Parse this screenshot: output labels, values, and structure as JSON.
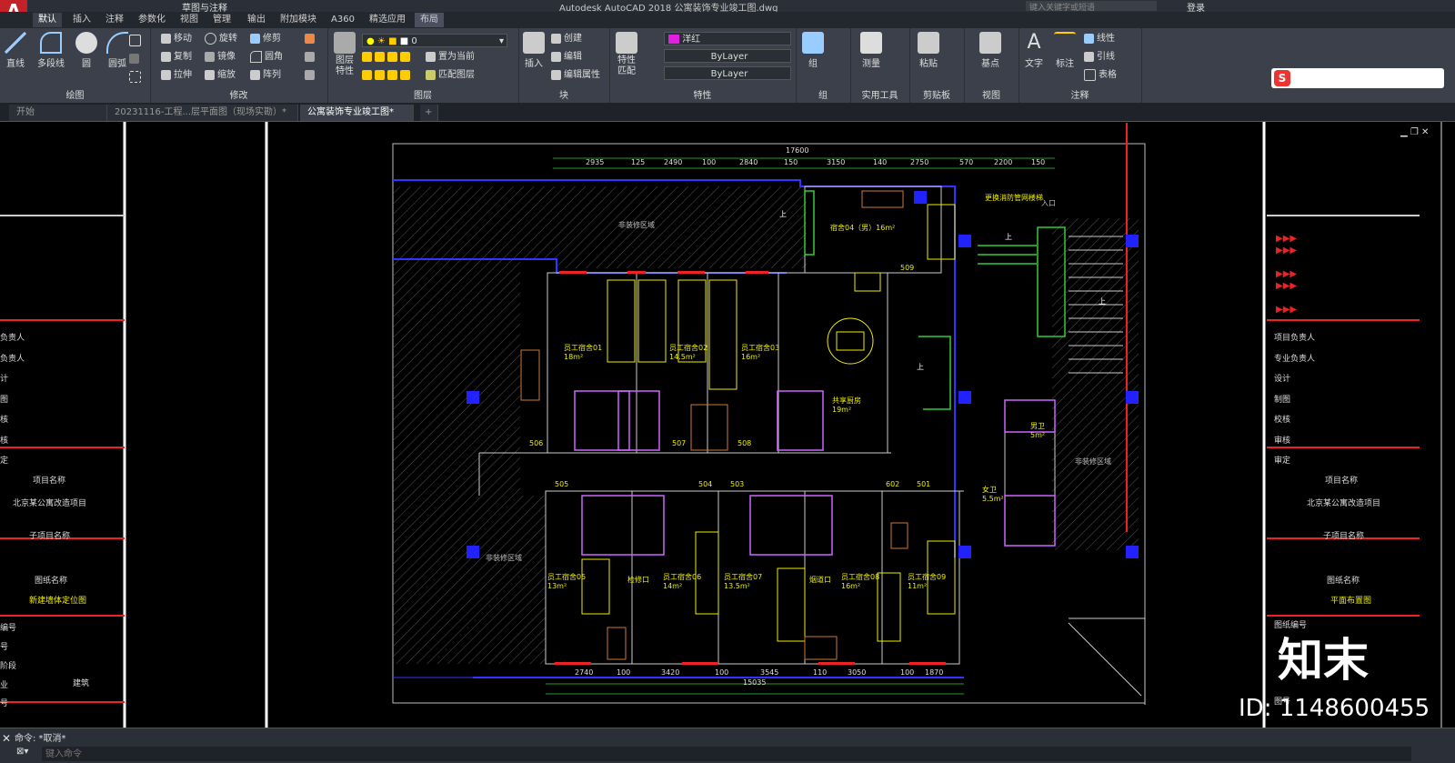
{
  "title_bar": {
    "app_logo": "A",
    "workspace": "草图与注释",
    "title": "Autodesk AutoCAD 2018    公寓装饰专业竣工图.dwg",
    "search_placeholder": "键入关键字或短语",
    "login": "登录"
  },
  "ribbon_tabs": [
    "默认",
    "插入",
    "注释",
    "参数化",
    "视图",
    "管理",
    "输出",
    "附加模块",
    "A360",
    "精选应用",
    "布局"
  ],
  "panels": {
    "draw": {
      "label": "绘图",
      "line": "直线",
      "polyline": "多段线",
      "circle": "圆",
      "arc": "圆弧"
    },
    "modify": {
      "label": "修改",
      "move": "移动",
      "rotate": "旋转",
      "trim": "修剪",
      "copy": "复制",
      "mirror": "镜像",
      "fillet": "圆角",
      "stretch": "拉伸",
      "scale": "缩放",
      "array": "阵列"
    },
    "layers": {
      "label": "图层",
      "props": "图层\n特性",
      "layer_value": "0",
      "make_current": "置为当前",
      "match_layer": "匹配图层"
    },
    "block": {
      "label": "块",
      "insert": "插入",
      "create": "创建",
      "edit": "编辑",
      "edit_attr": "编辑属性"
    },
    "properties": {
      "label": "特性",
      "match": "特性\n匹配",
      "color": "洋红",
      "linetype": "ByLayer",
      "lineweight": "ByLayer",
      "color_hex": "#e020e0"
    },
    "groups": {
      "label": "组",
      "group": "组"
    },
    "utilities": {
      "label": "实用工具",
      "measure": "测量"
    },
    "clipboard": {
      "label": "剪贴板",
      "paste": "粘贴"
    },
    "view": {
      "label": "视图",
      "base": "基点"
    },
    "annotation": {
      "label": "注释",
      "text": "文字",
      "dim": "标注",
      "linear": "线性",
      "leader": "引线",
      "table": "表格"
    }
  },
  "doc_tabs": [
    "开始",
    "20231116-工程...层平面图（现场实勘）*",
    "公寓装饰专业竣工图*",
    "+"
  ],
  "drawing": {
    "top_dims": [
      "17600",
      "2935",
      "125",
      "2490",
      "100",
      "2840",
      "150",
      "3150",
      "140",
      "2750",
      "570",
      "2200",
      "150"
    ],
    "bottom_dims": [
      "2740",
      "100",
      "3420",
      "100",
      "3545",
      "110",
      "3050",
      "100",
      "1870",
      "15035"
    ],
    "rooms": [
      {
        "name": "宿舍04（男）16m²"
      },
      {
        "name": "员工宿舍01",
        "area": "18m²"
      },
      {
        "name": "员工宿舍02",
        "area": "14.5m²"
      },
      {
        "name": "员工宿舍03",
        "area": "16m²"
      },
      {
        "name": "共享厨房",
        "area": "19m²"
      },
      {
        "name": "男卫",
        "area": "5m²"
      },
      {
        "name": "女卫",
        "area": "5.5m²"
      },
      {
        "name": "员工宿舍05",
        "area": "13m²"
      },
      {
        "name": "员工宿舍06",
        "area": "14m²"
      },
      {
        "name": "员工宿舍07",
        "area": "13.5m²"
      },
      {
        "name": "员工宿舍08",
        "area": "16m²"
      },
      {
        "name": "员工宿舍09",
        "area": "11m²"
      }
    ],
    "labels": [
      "非装修区域",
      "非装修区域",
      "非装修区域",
      "更换消防管网楼梯",
      "入口",
      "上",
      "上",
      "上",
      "上",
      "检修口",
      "烟道口",
      "506",
      "507",
      "508",
      "509",
      "505",
      "504",
      "503",
      "602",
      "501"
    ]
  },
  "title_block_left": {
    "rows": [
      "负责人",
      "负责人",
      "计",
      "图",
      "核",
      "核",
      "定"
    ],
    "project_label": "项目名称",
    "project": "北京某公寓改造项目",
    "sub_label": "子项目名称",
    "drawing_label": "图纸名称",
    "drawing_name": "新建墙体定位图",
    "misc": [
      "编号",
      "号",
      "阶段",
      "业",
      "建筑",
      "号"
    ]
  },
  "title_block_right": {
    "rows": [
      "项目负责人",
      "专业负责人",
      "设计",
      "制图",
      "校核",
      "审核",
      "审定"
    ],
    "project_label": "项目名称",
    "project": "北京某公寓改造项目",
    "sub_label": "子项目名称",
    "drawing_label": "图纸名称",
    "drawing_name": "平面布置图",
    "misc": [
      "图纸编号",
      "图号"
    ]
  },
  "command": {
    "history": "命令: *取消*",
    "placeholder": "键入命令"
  },
  "watermark": {
    "brand": "知末",
    "id": "ID: 1148600455"
  }
}
